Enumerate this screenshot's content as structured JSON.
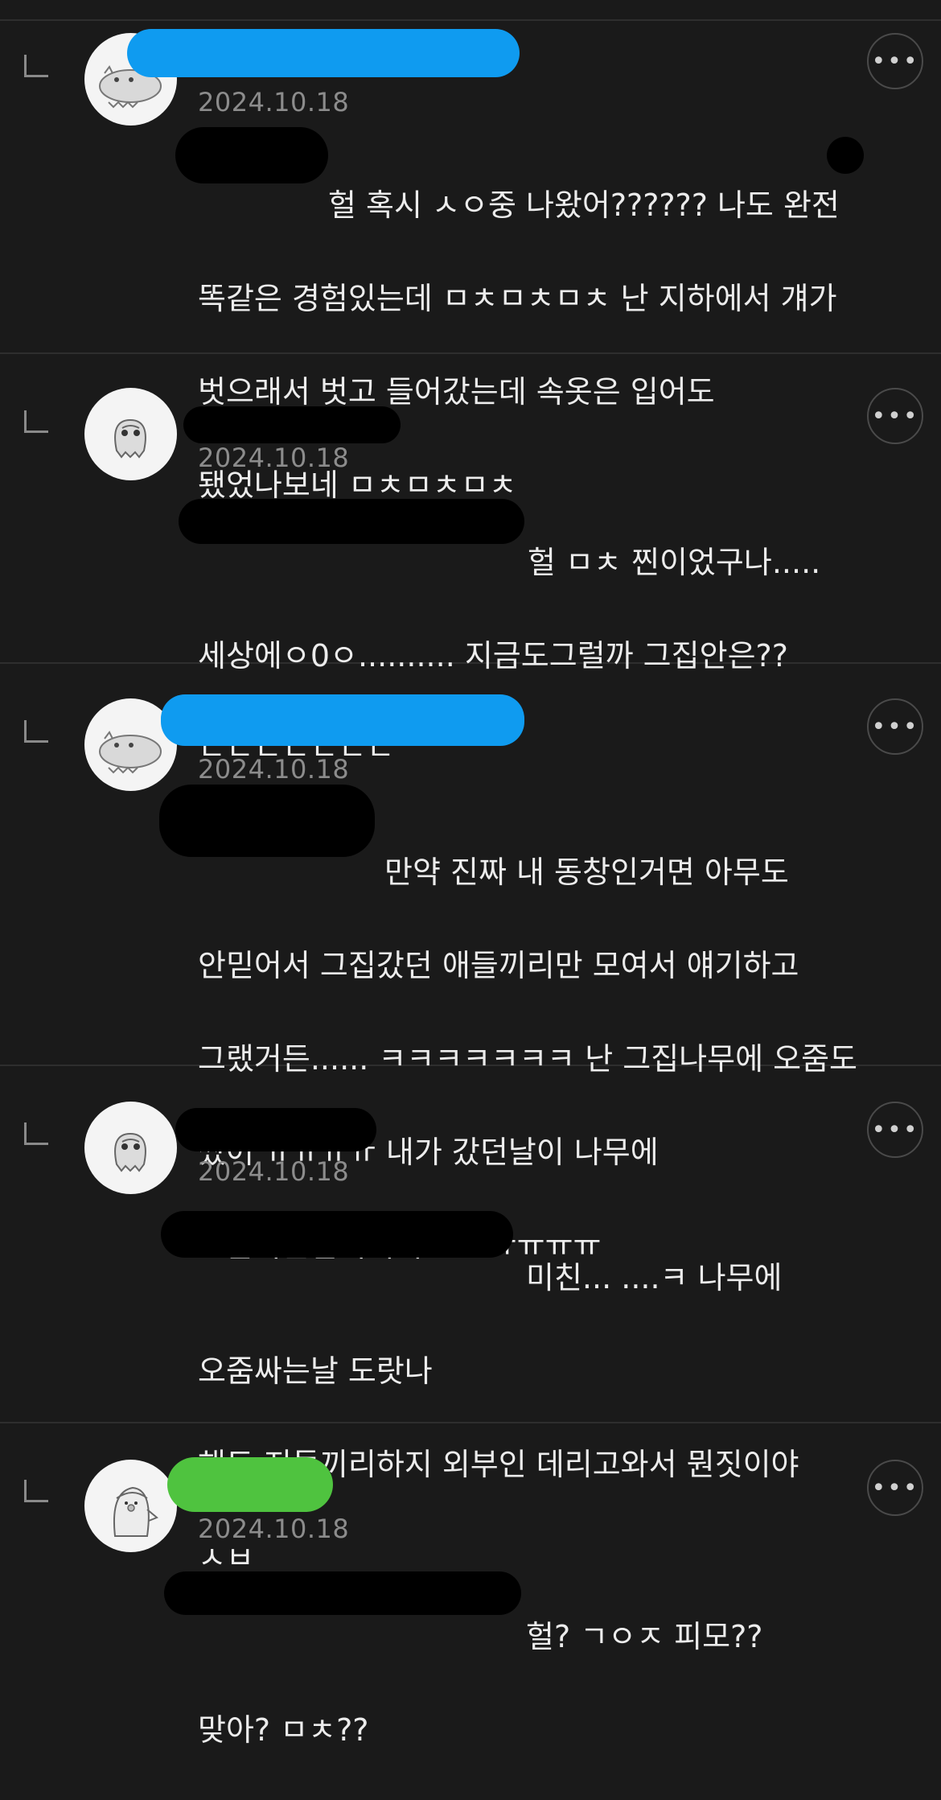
{
  "colors": {
    "background": "#1a1a1a",
    "text": "#ececec",
    "date": "#8c8c8c",
    "divider": "#2e2e2e",
    "redact_blue": "#0f9bf0",
    "redact_green": "#4fc33f",
    "redact_black": "#000000"
  },
  "comments": [
    {
      "avatar": "creature-avatar-icon",
      "date": "2024.10.18",
      "lines": [
        "헐 혹시 ㅅㅇ중 나왔어?????? 나도 완전",
        "똑같은 경험있는데 ㅁㅊㅁㅊㅁㅊ 난 지하에서 걔가",
        "벗으래서 벗고 들어갔는데 속옷은 입어도",
        "됐었나보네 ㅁㅊㅁㅊㅁㅊ"
      ]
    },
    {
      "avatar": "ghost-avatar-icon",
      "date": "2024.10.18",
      "lines": [
        "헐 ㅁㅊ 찐이었구나.....",
        "세상에ㅇ0ㅇ.......... 지금도그럴까 그집안은??",
        "ㄷㄷㄷㄷㄷㄷㄷ"
      ]
    },
    {
      "avatar": "creature-avatar-icon",
      "date": "2024.10.18",
      "lines": [
        "만약 진짜 내 동창인거면 아무도",
        "안믿어서 그집갔던 애들끼리만 모여서 얘기하고",
        "그랬거든...... ㅋㅋㅋㅋㅋㅋㅋ 난 그집나무에 오줌도",
        "쌌어 ㅠㅠㅠㅠ 내가 갔던날이 나무에",
        "오줌싸는날이여서 ㅠㅠㅠㅠㅠㅠ"
      ]
    },
    {
      "avatar": "ghost-avatar-icon",
      "date": "2024.10.18",
      "lines": [
        "미친... ....ㅋ 나무에",
        "오줌싸는날 도랏나",
        "해도 지들끼리하지 외부인 데리고와서 뭔짓이야",
        "ㅅㅂ"
      ]
    },
    {
      "avatar": "penguin-avatar-icon",
      "date": "2024.10.18",
      "lines": [
        "헐? ㄱㅇㅈ 피모??",
        "맞아? ㅁㅊ??"
      ]
    }
  ],
  "more_icon": "ellipsis-icon",
  "more_label": "•••"
}
